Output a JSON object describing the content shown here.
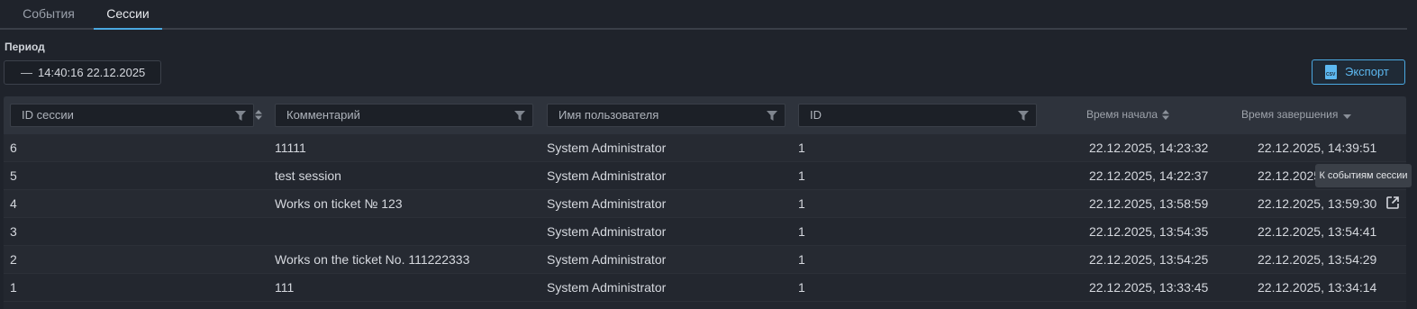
{
  "tabs": [
    {
      "label": "События",
      "active": false
    },
    {
      "label": "Сессии",
      "active": true
    }
  ],
  "period": {
    "label": "Период",
    "dash": "—",
    "value": "14:40:16 22.12.2025"
  },
  "export": {
    "label": "Экспорт",
    "icon": "csv-file-icon"
  },
  "columns": {
    "session_id": "ID сессии",
    "comment": "Комментарий",
    "username": "Имя пользователя",
    "id": "ID",
    "start_time": "Время начала",
    "end_time": "Время завершения"
  },
  "rows": [
    {
      "session_id": "6",
      "comment": "11111",
      "username": "System Administrator",
      "id": "1",
      "start": "22.12.2025, 14:23:32",
      "end": "22.12.2025, 14:39:51"
    },
    {
      "session_id": "5",
      "comment": "test session",
      "username": "System Administrator",
      "id": "1",
      "start": "22.12.2025, 14:22:37",
      "end": "22.12.2025"
    },
    {
      "session_id": "4",
      "comment": "Works on ticket № 123",
      "username": "System Administrator",
      "id": "1",
      "start": "22.12.2025, 13:58:59",
      "end": "22.12.2025, 13:59:30"
    },
    {
      "session_id": "3",
      "comment": "",
      "username": "System Administrator",
      "id": "1",
      "start": "22.12.2025, 13:54:35",
      "end": "22.12.2025, 13:54:41"
    },
    {
      "session_id": "2",
      "comment": "Works on the ticket No. 111222333",
      "username": "System Administrator",
      "id": "1",
      "start": "22.12.2025, 13:54:25",
      "end": "22.12.2025, 13:54:29"
    },
    {
      "session_id": "1",
      "comment": "111",
      "username": "System Administrator",
      "id": "1",
      "start": "22.12.2025, 13:33:45",
      "end": "22.12.2025, 13:34:14"
    }
  ],
  "tooltip": "К событиям сессии",
  "colors": {
    "accent": "#4aa8e0",
    "background": "#1f232b"
  }
}
